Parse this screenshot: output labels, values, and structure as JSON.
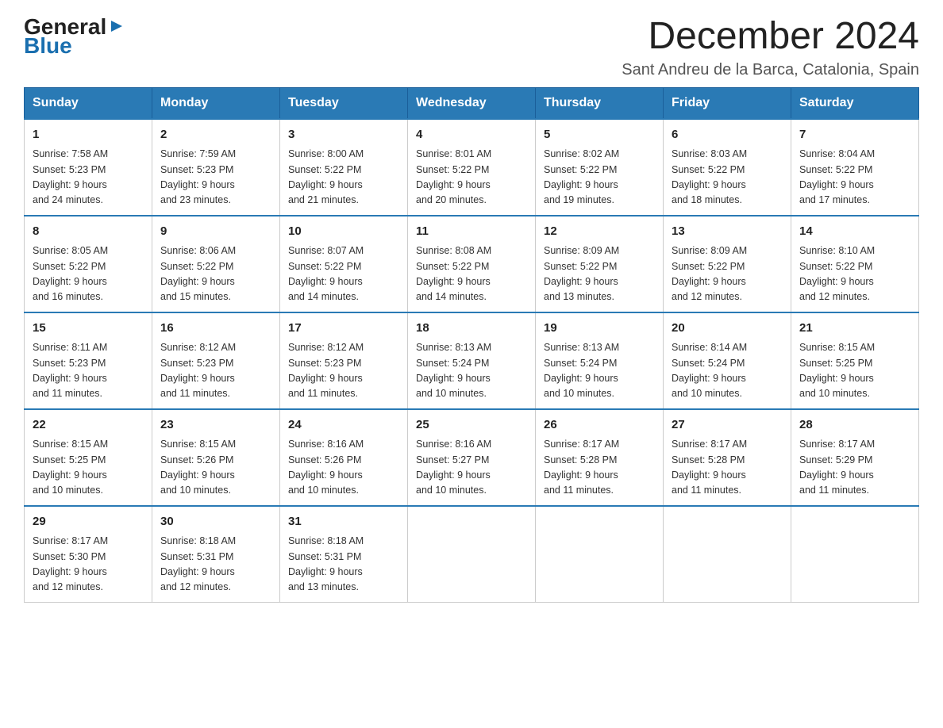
{
  "header": {
    "logo": {
      "general": "General",
      "blue": "Blue",
      "arrow": "▶"
    },
    "title": "December 2024",
    "location": "Sant Andreu de la Barca, Catalonia, Spain"
  },
  "calendar": {
    "days_of_week": [
      "Sunday",
      "Monday",
      "Tuesday",
      "Wednesday",
      "Thursday",
      "Friday",
      "Saturday"
    ],
    "weeks": [
      [
        {
          "day": "1",
          "info": "Sunrise: 7:58 AM\nSunset: 5:23 PM\nDaylight: 9 hours\nand 24 minutes."
        },
        {
          "day": "2",
          "info": "Sunrise: 7:59 AM\nSunset: 5:23 PM\nDaylight: 9 hours\nand 23 minutes."
        },
        {
          "day": "3",
          "info": "Sunrise: 8:00 AM\nSunset: 5:22 PM\nDaylight: 9 hours\nand 21 minutes."
        },
        {
          "day": "4",
          "info": "Sunrise: 8:01 AM\nSunset: 5:22 PM\nDaylight: 9 hours\nand 20 minutes."
        },
        {
          "day": "5",
          "info": "Sunrise: 8:02 AM\nSunset: 5:22 PM\nDaylight: 9 hours\nand 19 minutes."
        },
        {
          "day": "6",
          "info": "Sunrise: 8:03 AM\nSunset: 5:22 PM\nDaylight: 9 hours\nand 18 minutes."
        },
        {
          "day": "7",
          "info": "Sunrise: 8:04 AM\nSunset: 5:22 PM\nDaylight: 9 hours\nand 17 minutes."
        }
      ],
      [
        {
          "day": "8",
          "info": "Sunrise: 8:05 AM\nSunset: 5:22 PM\nDaylight: 9 hours\nand 16 minutes."
        },
        {
          "day": "9",
          "info": "Sunrise: 8:06 AM\nSunset: 5:22 PM\nDaylight: 9 hours\nand 15 minutes."
        },
        {
          "day": "10",
          "info": "Sunrise: 8:07 AM\nSunset: 5:22 PM\nDaylight: 9 hours\nand 14 minutes."
        },
        {
          "day": "11",
          "info": "Sunrise: 8:08 AM\nSunset: 5:22 PM\nDaylight: 9 hours\nand 14 minutes."
        },
        {
          "day": "12",
          "info": "Sunrise: 8:09 AM\nSunset: 5:22 PM\nDaylight: 9 hours\nand 13 minutes."
        },
        {
          "day": "13",
          "info": "Sunrise: 8:09 AM\nSunset: 5:22 PM\nDaylight: 9 hours\nand 12 minutes."
        },
        {
          "day": "14",
          "info": "Sunrise: 8:10 AM\nSunset: 5:22 PM\nDaylight: 9 hours\nand 12 minutes."
        }
      ],
      [
        {
          "day": "15",
          "info": "Sunrise: 8:11 AM\nSunset: 5:23 PM\nDaylight: 9 hours\nand 11 minutes."
        },
        {
          "day": "16",
          "info": "Sunrise: 8:12 AM\nSunset: 5:23 PM\nDaylight: 9 hours\nand 11 minutes."
        },
        {
          "day": "17",
          "info": "Sunrise: 8:12 AM\nSunset: 5:23 PM\nDaylight: 9 hours\nand 11 minutes."
        },
        {
          "day": "18",
          "info": "Sunrise: 8:13 AM\nSunset: 5:24 PM\nDaylight: 9 hours\nand 10 minutes."
        },
        {
          "day": "19",
          "info": "Sunrise: 8:13 AM\nSunset: 5:24 PM\nDaylight: 9 hours\nand 10 minutes."
        },
        {
          "day": "20",
          "info": "Sunrise: 8:14 AM\nSunset: 5:24 PM\nDaylight: 9 hours\nand 10 minutes."
        },
        {
          "day": "21",
          "info": "Sunrise: 8:15 AM\nSunset: 5:25 PM\nDaylight: 9 hours\nand 10 minutes."
        }
      ],
      [
        {
          "day": "22",
          "info": "Sunrise: 8:15 AM\nSunset: 5:25 PM\nDaylight: 9 hours\nand 10 minutes."
        },
        {
          "day": "23",
          "info": "Sunrise: 8:15 AM\nSunset: 5:26 PM\nDaylight: 9 hours\nand 10 minutes."
        },
        {
          "day": "24",
          "info": "Sunrise: 8:16 AM\nSunset: 5:26 PM\nDaylight: 9 hours\nand 10 minutes."
        },
        {
          "day": "25",
          "info": "Sunrise: 8:16 AM\nSunset: 5:27 PM\nDaylight: 9 hours\nand 10 minutes."
        },
        {
          "day": "26",
          "info": "Sunrise: 8:17 AM\nSunset: 5:28 PM\nDaylight: 9 hours\nand 11 minutes."
        },
        {
          "day": "27",
          "info": "Sunrise: 8:17 AM\nSunset: 5:28 PM\nDaylight: 9 hours\nand 11 minutes."
        },
        {
          "day": "28",
          "info": "Sunrise: 8:17 AM\nSunset: 5:29 PM\nDaylight: 9 hours\nand 11 minutes."
        }
      ],
      [
        {
          "day": "29",
          "info": "Sunrise: 8:17 AM\nSunset: 5:30 PM\nDaylight: 9 hours\nand 12 minutes."
        },
        {
          "day": "30",
          "info": "Sunrise: 8:18 AM\nSunset: 5:31 PM\nDaylight: 9 hours\nand 12 minutes."
        },
        {
          "day": "31",
          "info": "Sunrise: 8:18 AM\nSunset: 5:31 PM\nDaylight: 9 hours\nand 13 minutes."
        },
        {
          "day": "",
          "info": ""
        },
        {
          "day": "",
          "info": ""
        },
        {
          "day": "",
          "info": ""
        },
        {
          "day": "",
          "info": ""
        }
      ]
    ]
  }
}
